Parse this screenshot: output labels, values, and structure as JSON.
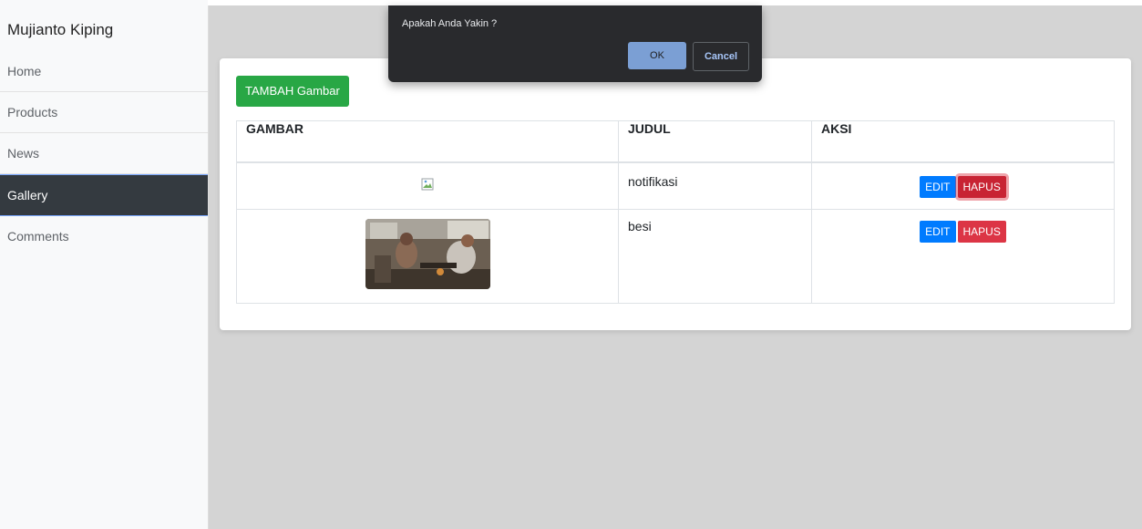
{
  "sidebar": {
    "brand": "Mujianto Kiping",
    "items": [
      {
        "label": "Home"
      },
      {
        "label": "Products"
      },
      {
        "label": "News"
      },
      {
        "label": "Gallery",
        "active": true
      },
      {
        "label": "Comments"
      }
    ]
  },
  "content": {
    "add_button": "TAMBAH Gambar",
    "table": {
      "headers": [
        "GAMBAR",
        "JUDUL",
        "AKSI"
      ],
      "rows": [
        {
          "image": "broken-image-icon",
          "title": "notifikasi",
          "edit": "EDIT",
          "delete": "HAPUS"
        },
        {
          "image": "workshop-photo",
          "title": "besi",
          "edit": "EDIT",
          "delete": "HAPUS"
        }
      ]
    }
  },
  "dialog": {
    "message": "Apakah Anda Yakin ?",
    "ok": "OK",
    "cancel": "Cancel"
  },
  "colors": {
    "success": "#28a745",
    "primary": "#007bff",
    "danger": "#dc3545",
    "sidebar_active": "#343a40"
  }
}
